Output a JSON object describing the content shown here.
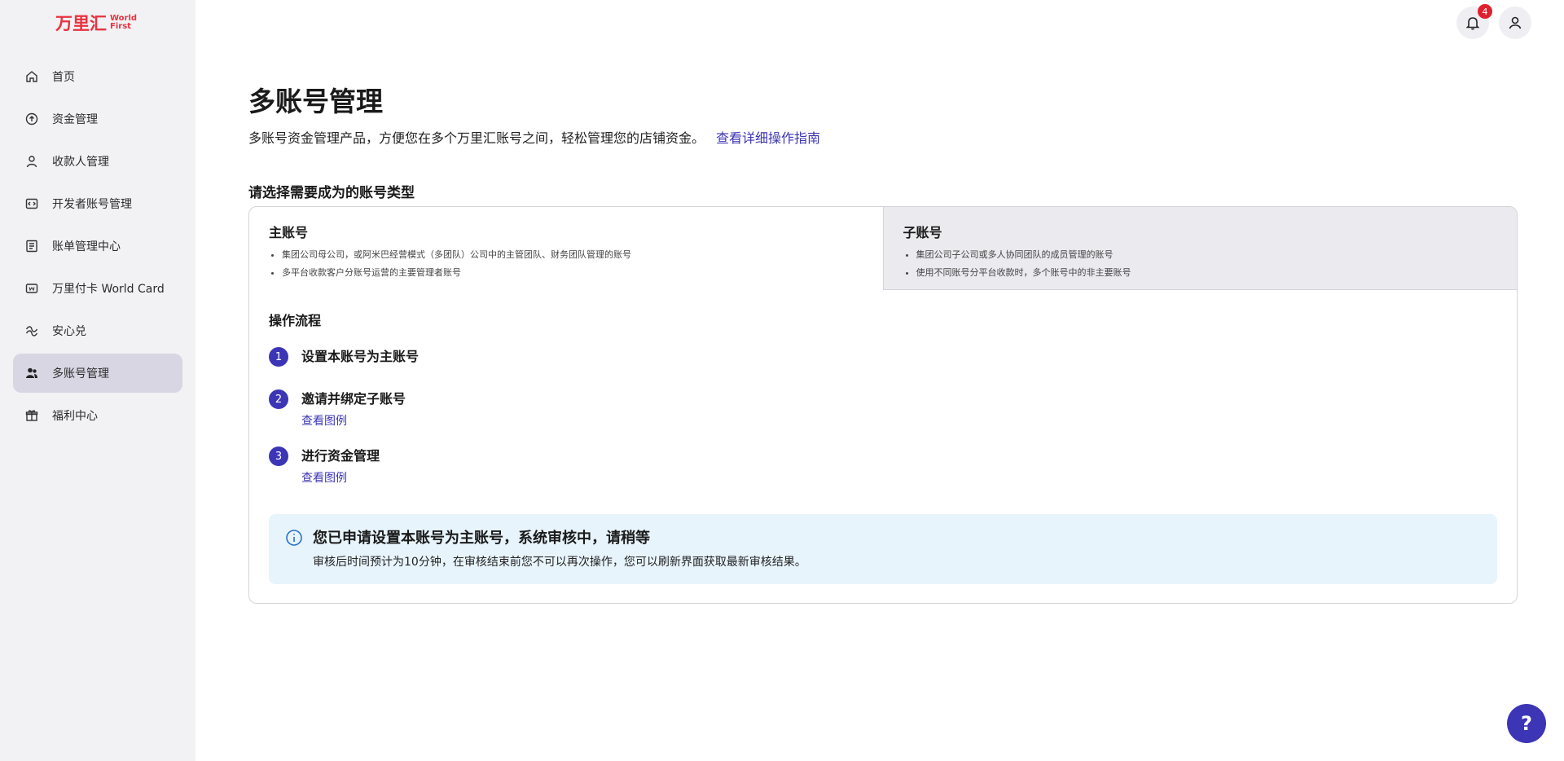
{
  "logo": {
    "cn": "万里汇",
    "en_line1": "World",
    "en_line2": "First"
  },
  "sidebar": {
    "items": [
      {
        "label": "首页",
        "icon": "home-icon",
        "active": false
      },
      {
        "label": "资金管理",
        "icon": "funds-icon",
        "active": false
      },
      {
        "label": "收款人管理",
        "icon": "payee-icon",
        "active": false
      },
      {
        "label": "开发者账号管理",
        "icon": "developer-icon",
        "active": false
      },
      {
        "label": "账单管理中心",
        "icon": "bill-icon",
        "active": false
      },
      {
        "label": "万里付卡 World Card",
        "icon": "card-icon",
        "active": false
      },
      {
        "label": "安心兑",
        "icon": "exchange-icon",
        "active": false
      },
      {
        "label": "多账号管理",
        "icon": "multi-account-icon",
        "active": true
      },
      {
        "label": "福利中心",
        "icon": "gift-icon",
        "active": false
      }
    ]
  },
  "header": {
    "notification_count": "4"
  },
  "main": {
    "title": "多账号管理",
    "subtitle": "多账号资金管理产品，方便您在多个万里汇账号之间，轻松管理您的店铺资金。",
    "guide_link": "查看详细操作指南",
    "section_title": "请选择需要成为的账号类型",
    "options": [
      {
        "title": "主账号",
        "bullets": [
          "集团公司母公司，或阿米巴经营模式（多团队）公司中的主管团队、财务团队管理的账号",
          "多平台收款客户分账号运营的主要管理者账号"
        ]
      },
      {
        "title": "子账号",
        "bullets": [
          "集团公司子公司或多人协同团队的成员管理的账号",
          "使用不同账号分平台收款时，多个账号中的非主要账号"
        ]
      }
    ],
    "flow_title": "操作流程",
    "steps": [
      {
        "num": "1",
        "title": "设置本账号为主账号",
        "link": ""
      },
      {
        "num": "2",
        "title": "邀请并绑定子账号",
        "link": "查看图例"
      },
      {
        "num": "3",
        "title": "进行资金管理",
        "link": "查看图例"
      }
    ],
    "notice": {
      "title": "您已申请设置本账号为主账号，系统审核中，请稍等",
      "text": "审核后时间预计为10分钟，在审核结束前您不可以再次操作，您可以刷新界面获取最新审核结果。"
    }
  },
  "help": {
    "label": "?"
  },
  "colors": {
    "brand": "#e8333e",
    "accent": "#3c35b5",
    "notice_bg": "#e8f4fc",
    "sidebar_bg": "#f2f1f4"
  }
}
